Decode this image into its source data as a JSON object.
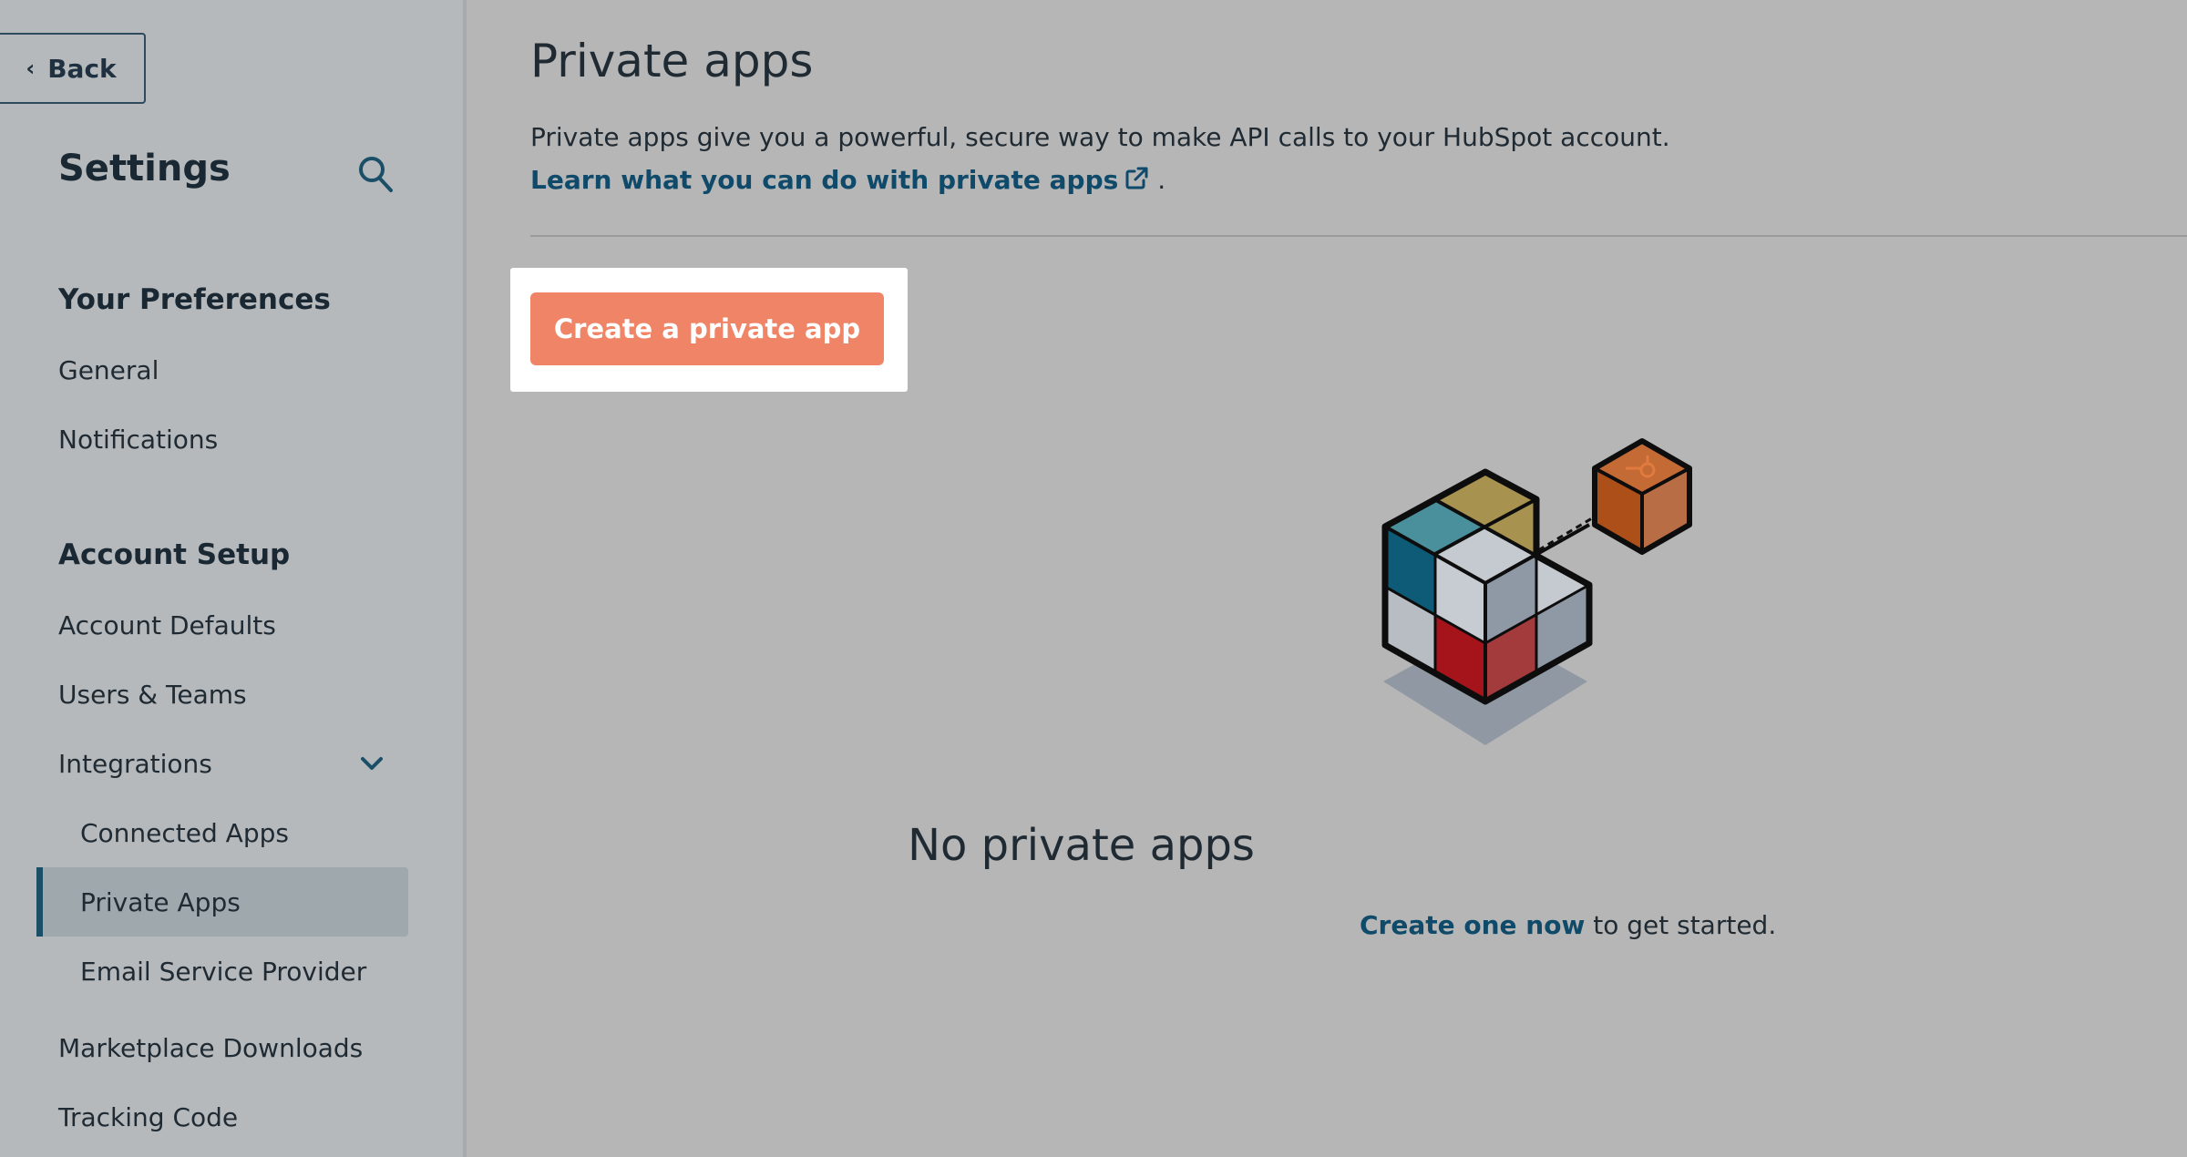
{
  "sidebar": {
    "back_label": "Back",
    "title": "Settings",
    "sections": [
      {
        "heading": "Your Preferences",
        "items": [
          "General",
          "Notifications"
        ]
      },
      {
        "heading": "Account Setup"
      }
    ],
    "account_setup_items": {
      "account_defaults": "Account Defaults",
      "users_teams": "Users & Teams",
      "integrations": "Integrations",
      "connected_apps": "Connected Apps",
      "private_apps": "Private Apps",
      "email_service_provider": "Email Service Provider",
      "marketplace_downloads": "Marketplace Downloads",
      "tracking_code": "Tracking Code"
    },
    "active_item": "Private Apps"
  },
  "main": {
    "title": "Private apps",
    "description": "Private apps give you a powerful, secure way to make API calls to your HubSpot account.",
    "learn_link": "Learn what you can do with private apps",
    "learn_suffix": ".",
    "create_button": "Create a private app",
    "empty_title": "No private apps",
    "empty_link": "Create one now",
    "empty_suffix": " to get started."
  },
  "colors": {
    "accent_button": "#ef8566",
    "link": "#0f4a6a",
    "active_nav_bar": "#1b4f68"
  },
  "icons": [
    "chevron-left-icon",
    "search-icon",
    "chevron-down-icon",
    "external-link-icon",
    "cube-illustration"
  ]
}
